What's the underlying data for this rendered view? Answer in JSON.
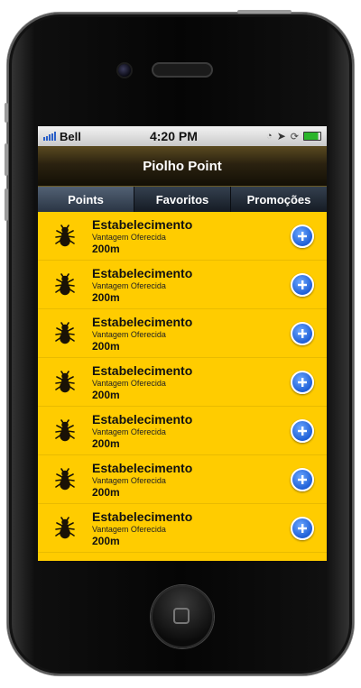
{
  "status_bar": {
    "carrier": "Bell",
    "time": "4:20 PM"
  },
  "nav": {
    "title": "Piolho Point"
  },
  "tabs": [
    {
      "label": "Points",
      "active": true
    },
    {
      "label": "Favoritos",
      "active": false
    },
    {
      "label": "Promoções",
      "active": false
    }
  ],
  "list": {
    "items": [
      {
        "title": "Estabelecimento",
        "subtitle": "Vantagem Oferecida",
        "distance": "200m",
        "icon": "louse-icon",
        "action_icon": "add-circle-icon"
      },
      {
        "title": "Estabelecimento",
        "subtitle": "Vantagem Oferecida",
        "distance": "200m",
        "icon": "louse-icon",
        "action_icon": "add-circle-icon"
      },
      {
        "title": "Estabelecimento",
        "subtitle": "Vantagem Oferecida",
        "distance": "200m",
        "icon": "louse-icon",
        "action_icon": "add-circle-icon"
      },
      {
        "title": "Estabelecimento",
        "subtitle": "Vantagem Oferecida",
        "distance": "200m",
        "icon": "louse-icon",
        "action_icon": "add-circle-icon"
      },
      {
        "title": "Estabelecimento",
        "subtitle": "Vantagem Oferecida",
        "distance": "200m",
        "icon": "louse-icon",
        "action_icon": "add-circle-icon"
      },
      {
        "title": "Estabelecimento",
        "subtitle": "Vantagem Oferecida",
        "distance": "200m",
        "icon": "louse-icon",
        "action_icon": "add-circle-icon"
      },
      {
        "title": "Estabelecimento",
        "subtitle": "Vantagem Oferecida",
        "distance": "200m",
        "icon": "louse-icon",
        "action_icon": "add-circle-icon"
      }
    ]
  },
  "colors": {
    "list_background": "#ffcc00",
    "accent_button": "#1f5fd6",
    "nav_background": "#2b2210"
  }
}
